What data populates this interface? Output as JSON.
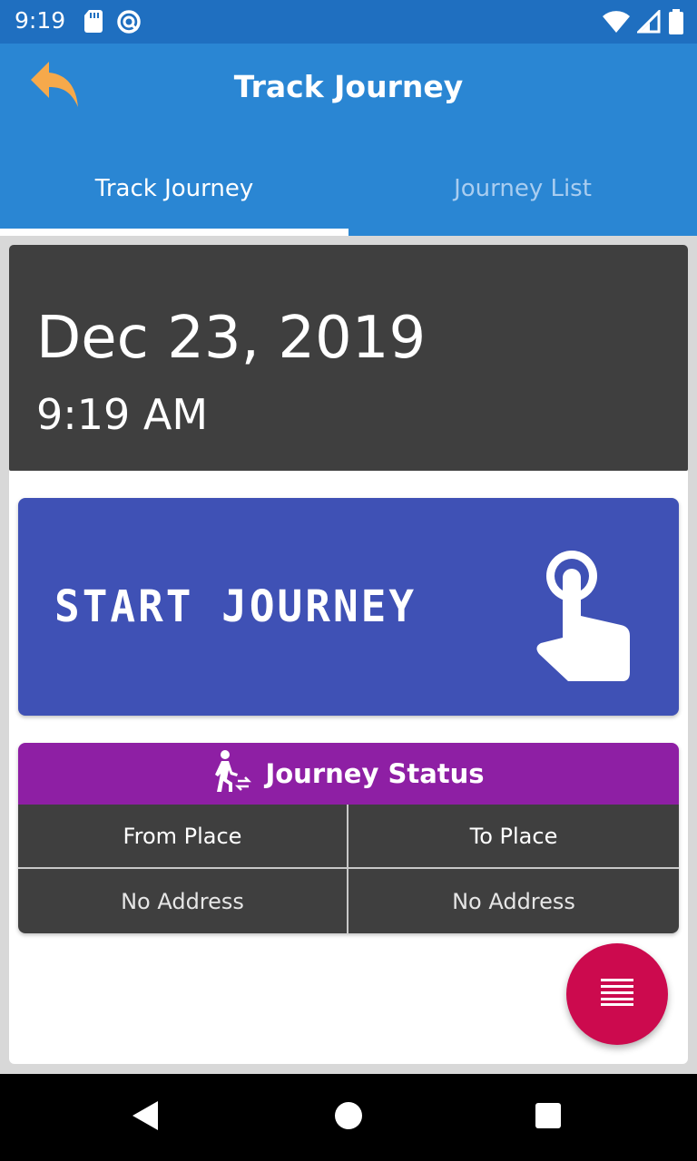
{
  "status_bar": {
    "time": "9:19",
    "icons": [
      "sd-card-icon",
      "do-not-disturb-icon",
      "wifi-icon",
      "signal-icon",
      "battery-icon"
    ]
  },
  "app_bar": {
    "title": "Track Journey",
    "back_icon": "reply-arrow-icon",
    "back_icon_color": "#f6a94b",
    "background": "#2a86d3"
  },
  "tabs": [
    {
      "label": "Track Journey",
      "active": true
    },
    {
      "label": "Journey List",
      "active": false
    }
  ],
  "date_card": {
    "date": "Dec 23, 2019",
    "time": "9:19 AM"
  },
  "start_button": {
    "label": "START JOURNEY",
    "icon": "tap-hand-icon",
    "color": "#3f51b5"
  },
  "journey_status": {
    "title": "Journey Status",
    "icon": "walking-person-transfer-icon",
    "header_color": "#8e1fa4",
    "columns": [
      "From Place",
      "To Place"
    ],
    "values": [
      "No Address",
      "No Address"
    ]
  },
  "fab": {
    "icon": "menu-lines-icon",
    "color": "#cc0a4e"
  },
  "nav_bar": {
    "buttons": [
      "back-triangle-icon",
      "home-circle-icon",
      "recents-square-icon"
    ]
  }
}
